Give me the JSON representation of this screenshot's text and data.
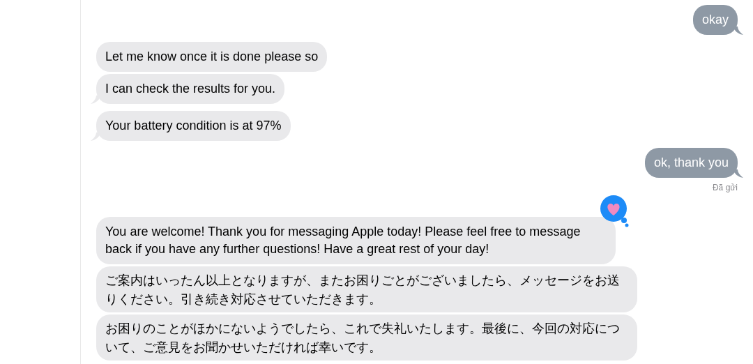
{
  "messages": [
    {
      "kind": "sent",
      "text": "okay",
      "tail": true,
      "reacted": false
    },
    {
      "kind": "received",
      "text": "Let me know once it is done please so",
      "tail": false,
      "reacted": false
    },
    {
      "kind": "received",
      "text": "I can check the results for you.",
      "tail": true,
      "reacted": false
    },
    {
      "kind": "received",
      "text": "Your battery condition is at 97%",
      "tail": true,
      "reacted": false
    },
    {
      "kind": "sent",
      "text": "ok, thank you",
      "tail": true,
      "reacted": false,
      "status": "Đã gửi"
    },
    {
      "kind": "received",
      "text": "You are welcome! Thank you for messaging Apple today! Please feel free to message back if you have any further questions! Have a great rest of your day!",
      "tail": false,
      "reacted": true
    },
    {
      "kind": "received",
      "text": "ご案内はいったん以上となりますが、またお困りごとがございましたら、メッセージをお送りください。引き続き対応させていただきます。",
      "tail": false,
      "reacted": false
    },
    {
      "kind": "received",
      "text": "お困りのことがほかにないようでしたら、これで失礼いたします。最後に、今回の対応について、ご意見をお聞かせいただければ幸いです。",
      "tail": false,
      "reacted": false
    }
  ]
}
